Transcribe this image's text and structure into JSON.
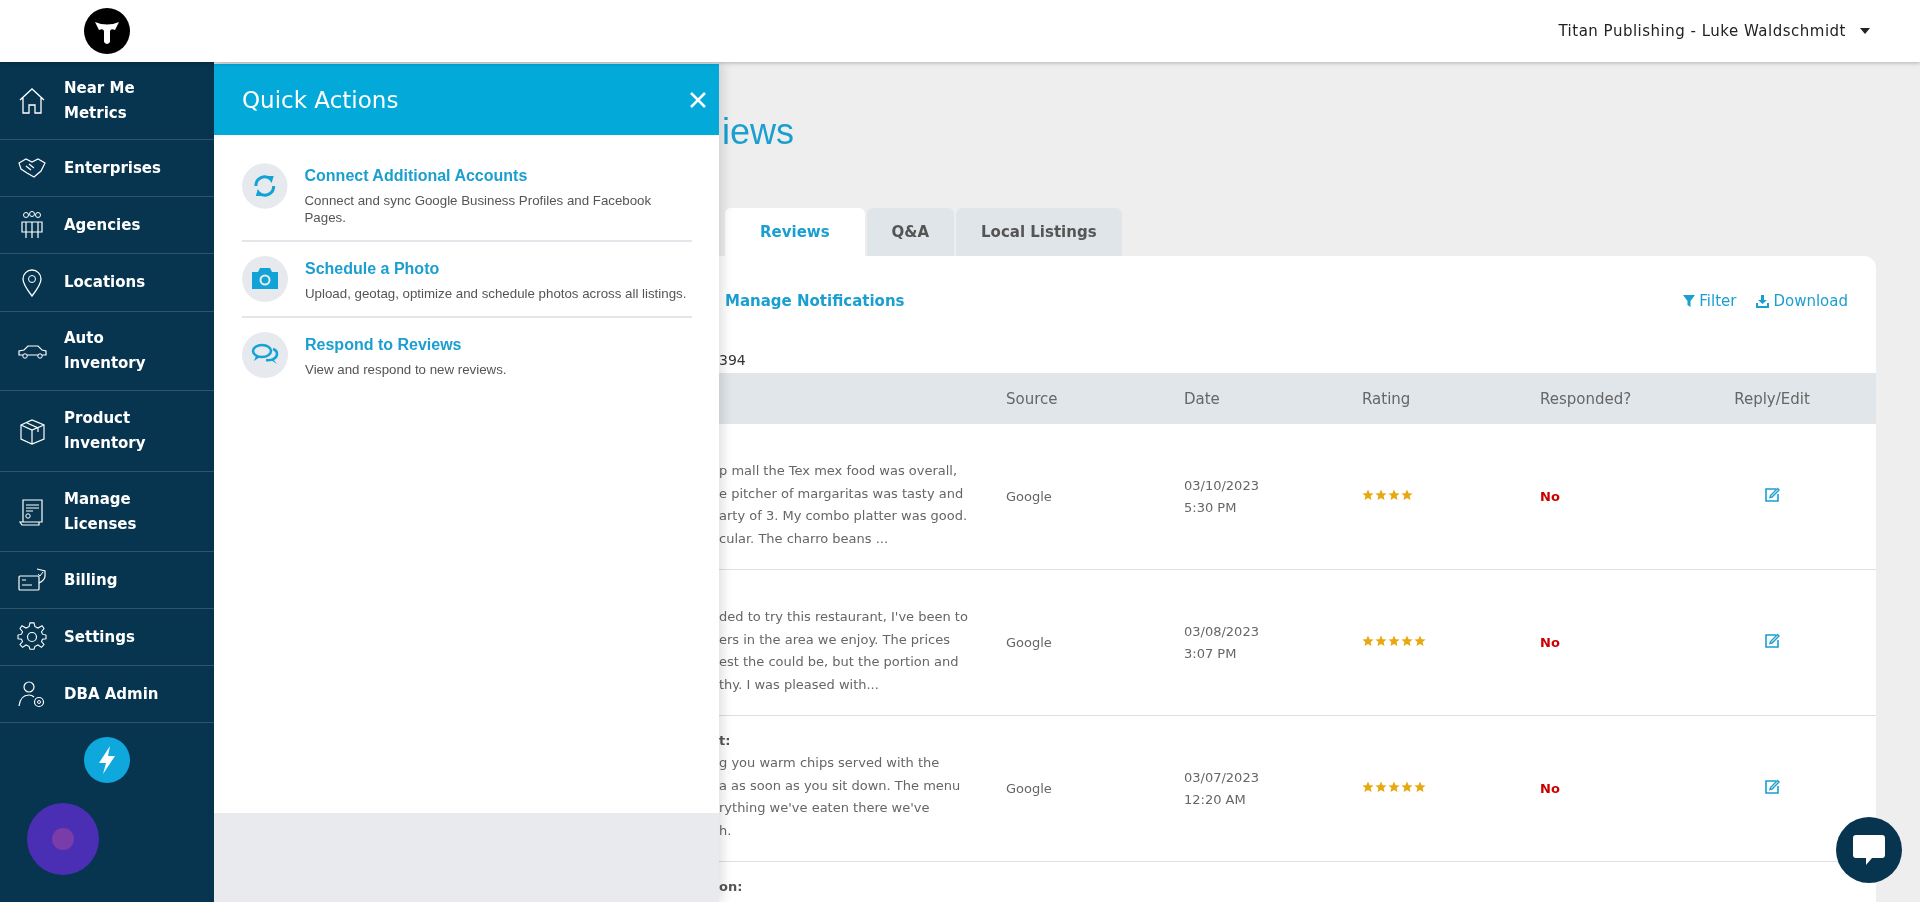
{
  "header": {
    "account": "Titan Publishing - Luke Waldschmidt"
  },
  "sidebar": {
    "items": [
      {
        "label": "Near Me Metrics"
      },
      {
        "label": "Enterprises"
      },
      {
        "label": "Agencies"
      },
      {
        "label": "Locations"
      },
      {
        "label": "Auto Inventory"
      },
      {
        "label": "Product Inventory"
      },
      {
        "label": "Manage Licenses"
      },
      {
        "label": "Billing"
      },
      {
        "label": "Settings"
      },
      {
        "label": "DBA Admin"
      }
    ]
  },
  "quick_actions": {
    "title": "Quick Actions",
    "items": [
      {
        "title": "Connect Additional Accounts",
        "description": "Connect and sync Google Business Profiles and Facebook Pages."
      },
      {
        "title": "Schedule a Photo",
        "description": "Upload, geotag, optimize and schedule photos across all listings."
      },
      {
        "title": "Respond to Reviews",
        "description": "View and respond to new reviews."
      }
    ]
  },
  "page": {
    "title": "iews",
    "tabs": [
      {
        "label": "Reviews",
        "selected": true
      },
      {
        "label": "Q&A",
        "selected": false
      },
      {
        "label": "Local Listings",
        "selected": false
      }
    ],
    "manage_link": "Manage Notifications",
    "filter": "Filter",
    "download": "Download",
    "count": "394",
    "table": {
      "columns": [
        "Source",
        "Date",
        "Rating",
        "Responded?",
        "Reply/Edit"
      ],
      "rows": [
        {
          "review_lines": [
            "p mall the Tex mex food was overall,",
            "e pitcher of margaritas was tasty and",
            "arty of 3. My combo platter was good.",
            "cular. The charro beans ..."
          ],
          "source": "Google",
          "date": "03/10/2023",
          "time": "5:30 PM",
          "stars": 4,
          "responded": "No"
        },
        {
          "review_lines": [
            "ded to try this restaurant, I've been to",
            "ers in the area we enjoy. The prices",
            "est the could be, but the portion and",
            "thy. I was pleased with..."
          ],
          "source": "Google",
          "date": "03/08/2023",
          "time": "3:07 PM",
          "stars": 5,
          "responded": "No"
        },
        {
          "title": "t:",
          "review_lines": [
            "g you warm chips served with the",
            "a as soon as you sit down. The menu",
            "rything we've eaten there we've",
            "h."
          ],
          "source": "Google",
          "date": "03/07/2023",
          "time": "12:20 AM",
          "stars": 5,
          "responded": "No"
        },
        {
          "title": "on:"
        }
      ]
    }
  }
}
